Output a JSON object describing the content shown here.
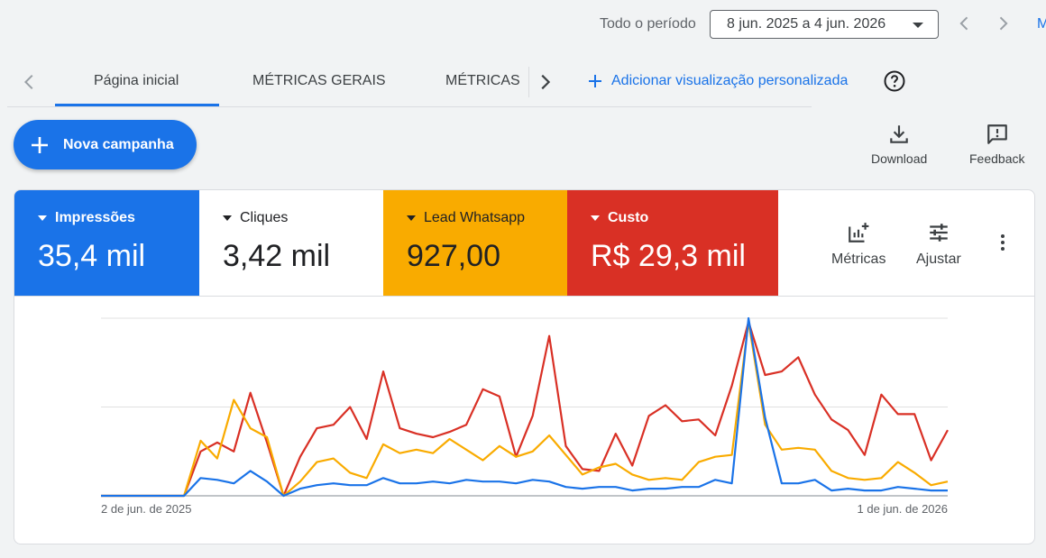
{
  "header": {
    "period_label": "Todo o período",
    "date_range": "8 jun. 2025 a 4 jun. 2026",
    "cut_text": "M"
  },
  "tabs": [
    {
      "label": "Página inicial",
      "active": true
    },
    {
      "label": "MÉTRICAS GERAIS"
    },
    {
      "label": "MÉTRICAS"
    }
  ],
  "add_view_label": "Adicionar visualização personalizada",
  "new_campaign_label": "Nova campanha",
  "toolbar": {
    "download_label": "Download",
    "feedback_label": "Feedback"
  },
  "metrics": [
    {
      "label": "Impressões",
      "value": "35,4 mil",
      "color": "#1a73e8"
    },
    {
      "label": "Cliques",
      "value": "3,42 mil",
      "color": "#ffffff"
    },
    {
      "label": "Lead Whatsapp",
      "value": "927,00",
      "color": "#f9ab00"
    },
    {
      "label": "Custo",
      "value": "R$ 29,3 mil",
      "color": "#d93025"
    }
  ],
  "card_tools": {
    "metricas_label": "Métricas",
    "ajustar_label": "Ajustar"
  },
  "chart_data": {
    "type": "line",
    "x_start_label": "2 de jun. de 2025",
    "x_end_label": "1 de jun. de 2026",
    "grid": true,
    "ylim": [
      0,
      100
    ],
    "series": [
      {
        "color": "#d93025",
        "values": [
          0,
          0,
          0,
          0,
          0,
          0,
          25,
          30,
          25,
          58,
          30,
          0,
          22,
          38,
          40,
          50,
          32,
          70,
          38,
          35,
          33,
          36,
          40,
          60,
          56,
          22,
          45,
          90,
          28,
          15,
          14,
          35,
          17,
          45,
          51,
          42,
          43,
          34,
          62,
          98,
          68,
          70,
          78,
          57,
          43,
          37,
          23,
          57,
          46,
          46,
          20,
          37
        ]
      },
      {
        "color": "#f9ab00",
        "values": [
          0,
          0,
          0,
          0,
          0,
          0,
          31,
          21,
          54,
          38,
          33,
          0,
          8,
          19,
          21,
          13,
          10,
          29,
          24,
          26,
          24,
          32,
          26,
          20,
          28,
          22,
          25,
          34,
          23,
          12,
          16,
          18,
          12,
          9,
          10,
          9,
          19,
          22,
          23,
          98,
          40,
          26,
          27,
          26,
          14,
          10,
          9,
          10,
          19,
          13,
          6,
          8
        ]
      },
      {
        "color": "#1a73e8",
        "values": [
          0,
          0,
          0,
          0,
          0,
          0,
          10,
          9,
          7,
          14,
          8,
          0,
          4,
          6,
          7,
          6,
          6,
          10,
          7,
          7,
          8,
          7,
          9,
          8,
          8,
          7,
          9,
          8,
          5,
          4,
          5,
          5,
          3,
          4,
          4,
          5,
          5,
          9,
          7,
          100,
          44,
          7,
          7,
          9,
          3,
          4,
          3,
          3,
          5,
          4,
          3,
          3
        ]
      }
    ]
  }
}
